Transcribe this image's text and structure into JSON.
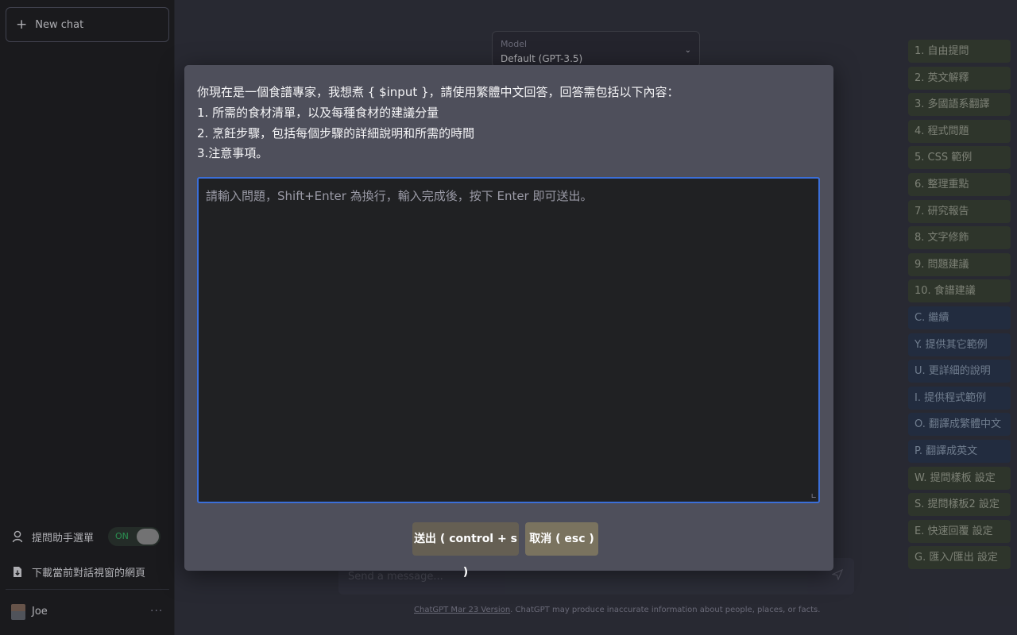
{
  "sidebar": {
    "new_chat_label": "New chat",
    "assistant_menu_label": "提問助手選單",
    "toggle_state": "ON",
    "download_label": "下載當前對話視窗的網頁",
    "user_name": "Joe",
    "more_label": "···"
  },
  "main": {
    "model_caption": "Model",
    "model_value": "Default (GPT-3.5)",
    "send_placeholder": "Send a message...",
    "footer_link": "ChatGPT Mar 23 Version",
    "footer_text": ". ChatGPT may produce inaccurate information about people, places, or facts."
  },
  "right_buttons": [
    {
      "label": "1. 自由提問",
      "color": "green"
    },
    {
      "label": "2. 英文解釋",
      "color": "green"
    },
    {
      "label": "3. 多國語系翻譯",
      "color": "green"
    },
    {
      "label": "4. 程式問題",
      "color": "green"
    },
    {
      "label": "5. CSS 範例",
      "color": "green"
    },
    {
      "label": "6. 整理重點",
      "color": "green"
    },
    {
      "label": "7. 研究報告",
      "color": "green"
    },
    {
      "label": "8. 文字修飾",
      "color": "green"
    },
    {
      "label": "9. 問題建議",
      "color": "green"
    },
    {
      "label": "10. 食譜建議",
      "color": "green"
    },
    {
      "label": "C. 繼續",
      "color": "blue"
    },
    {
      "label": "Y. 提供其它範例",
      "color": "blue"
    },
    {
      "label": "U. 更詳細的說明",
      "color": "blue"
    },
    {
      "label": "I. 提供程式範例",
      "color": "blue"
    },
    {
      "label": "O. 翻譯成繁體中文",
      "color": "blue"
    },
    {
      "label": "P. 翻譯成英文",
      "color": "blue"
    },
    {
      "label": "W. 提問樣板 設定",
      "color": "green"
    },
    {
      "label": "S. 提問樣板2 設定",
      "color": "green"
    },
    {
      "label": "E. 快速回覆 設定",
      "color": "green"
    },
    {
      "label": "G. 匯入/匯出 設定",
      "color": "green"
    }
  ],
  "modal": {
    "prompt_lines": [
      "你現在是一個食譜專家，我想煮 { $input }，請使用繁體中文回答，回答需包括以下內容：",
      "1. 所需的食材清單，以及每種食材的建議分量",
      "2. 烹飪步驟，包括每個步驟的詳細說明和所需的時間",
      "3.注意事項。"
    ],
    "input_placeholder": "請輸入問題，Shift+Enter 為換行，輸入完成後，按下 Enter 即可送出。",
    "submit_label": "送出 ( control + s )",
    "cancel_label": "取消 ( esc )"
  },
  "colors": {
    "sidebar_bg": "#202123",
    "main_bg": "#343541",
    "modal_bg": "#4e4f5b",
    "focus_border": "#3b6fd8",
    "green_button": "#3c4637",
    "blue_button": "#2b3a53",
    "toggle_on_text": "#37c46b"
  }
}
